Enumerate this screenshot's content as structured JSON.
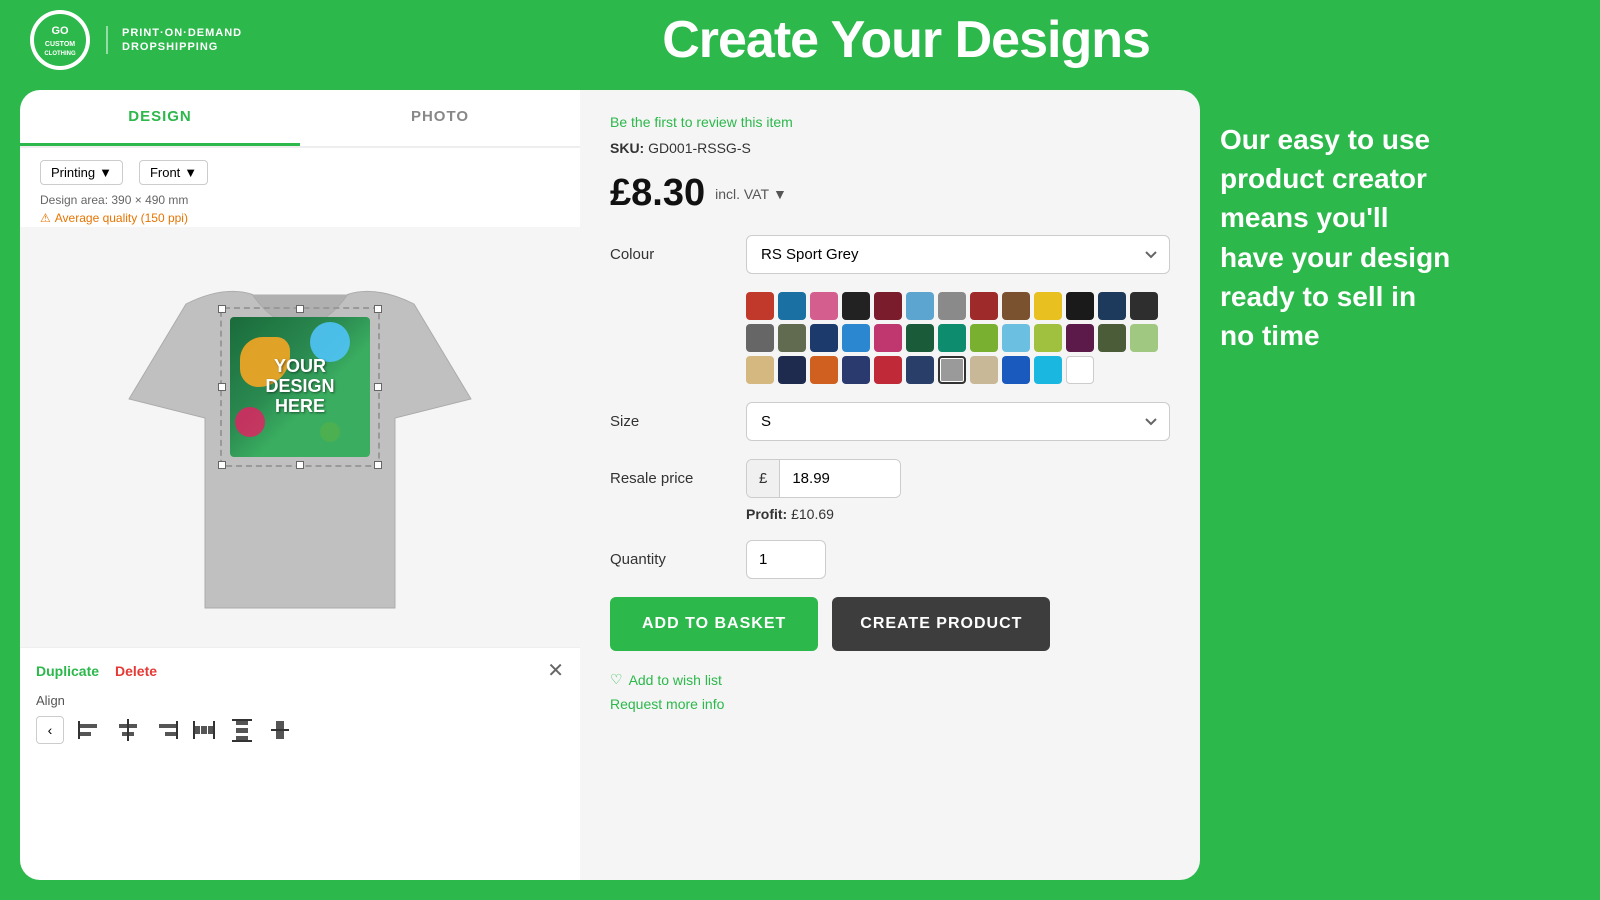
{
  "header": {
    "logo_badge": "GO",
    "logo_name": "custom\nclothing",
    "logo_tagline": "PRINT·ON·DEMAND\nDROPSHIPPING",
    "title": "Create Your Designs"
  },
  "tabs": {
    "design_label": "DESIGN",
    "photo_label": "PHOTO"
  },
  "toolbar": {
    "printing_label": "Printing",
    "front_label": "Front",
    "design_area": "Design area: 390 × 490 mm",
    "quality_warning": "Average quality (150 ppi)"
  },
  "bottom_controls": {
    "duplicate_label": "Duplicate",
    "delete_label": "Delete",
    "align_label": "Align"
  },
  "product": {
    "review_text": "Be the first to review this item",
    "sku_label": "SKU:",
    "sku_value": "GD001-RSSG-S",
    "price": "£8.30",
    "vat_label": "incl. VAT",
    "colour_label": "Colour",
    "colour_selected": "RS Sport Grey",
    "size_label": "Size",
    "size_selected": "S",
    "resale_label": "Resale price",
    "currency_symbol": "£",
    "resale_value": "18.99",
    "profit_label": "Profit:",
    "profit_value": "£10.69",
    "quantity_label": "Quantity",
    "quantity_value": "1",
    "add_basket_label": "ADD TO BASKET",
    "create_product_label": "CREATE PRODUCT",
    "wish_label": "Add to wish list",
    "request_label": "Request more info"
  },
  "side_text": {
    "line1": "Our easy to use",
    "line2": "product creator",
    "line3": "means you'll",
    "line4": "have your design",
    "line5": "ready to sell in",
    "line6": "no time"
  },
  "colors": [
    "#c0392b",
    "#1a6fa3",
    "#d45f8e",
    "#222222",
    "#7b1c2c",
    "#5ba5d0",
    "#8a8a8a",
    "#9e2a2a",
    "#7a5230",
    "#e8c020",
    "#1a1a1a",
    "#1d3a5c",
    "#2e2e2e",
    "#666666",
    "#606b50",
    "#1c3a6b",
    "#2b87d0",
    "#c0366e",
    "#1a5c3a",
    "#0d8c6e",
    "#7ab030",
    "#6bbfe0",
    "#a0c040",
    "#5c1a4a",
    "#4a5c38",
    "#a0c880",
    "#d4b880",
    "#1e2a4e",
    "#d06020",
    "#2a3a6e",
    "#c02a38",
    "#2a3e6a",
    "#9a9a9a",
    "#c8b898",
    "#1a5abf",
    "#1ab8e0",
    "#ffffff"
  ]
}
